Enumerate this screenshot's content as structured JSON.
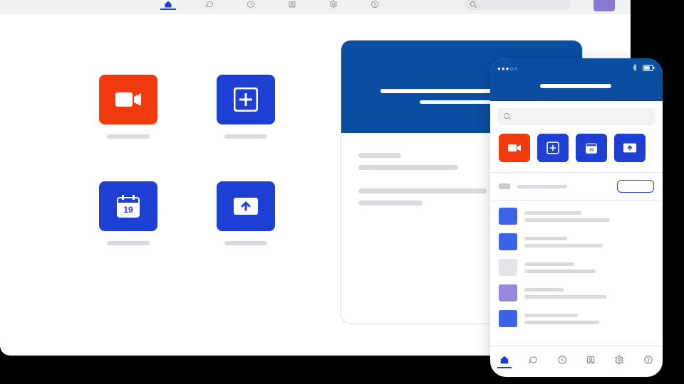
{
  "colors": {
    "brand_blue": "#1e3fd4",
    "header_blue": "#0a4ea1",
    "accent_orange": "#f13a0e",
    "accent_purple": "#8b77d4"
  },
  "desktop": {
    "nav": [
      {
        "icon": "home-icon",
        "active": true
      },
      {
        "icon": "chat-icon",
        "active": false
      },
      {
        "icon": "clock-icon",
        "active": false
      },
      {
        "icon": "contacts-icon",
        "active": false
      },
      {
        "icon": "gear-icon",
        "active": false
      },
      {
        "icon": "help-icon",
        "active": false
      }
    ],
    "search_placeholder": "",
    "tiles": [
      {
        "name": "new-meeting",
        "color": "orange",
        "icon": "video-icon",
        "label": ""
      },
      {
        "name": "join",
        "color": "blue",
        "icon": "plus-icon",
        "label": ""
      },
      {
        "name": "schedule",
        "color": "blue",
        "icon": "calendar-icon",
        "date": "19",
        "label": ""
      },
      {
        "name": "share",
        "color": "blue",
        "icon": "upload-icon",
        "label": ""
      }
    ]
  },
  "card": {
    "lines": 4
  },
  "phone": {
    "status": {
      "carrier": "●●●○○",
      "bluetooth": true,
      "battery": true
    },
    "title": "",
    "search_placeholder": "",
    "tiles": [
      {
        "name": "new-meeting",
        "color": "orange",
        "icon": "video-icon"
      },
      {
        "name": "join",
        "color": "blue",
        "icon": "plus-icon"
      },
      {
        "name": "schedule",
        "color": "blue",
        "icon": "calendar-icon",
        "date": "19"
      },
      {
        "name": "share",
        "color": "blue",
        "icon": "upload-icon"
      }
    ],
    "list": [
      {
        "thumb": "blue"
      },
      {
        "thumb": "blue"
      },
      {
        "thumb": "gray"
      },
      {
        "thumb": "purple"
      },
      {
        "thumb": "blue"
      }
    ],
    "tabs": [
      {
        "icon": "home-icon",
        "active": true
      },
      {
        "icon": "chat-icon",
        "active": false
      },
      {
        "icon": "clock-icon",
        "active": false
      },
      {
        "icon": "contacts-icon",
        "active": false
      },
      {
        "icon": "gear-icon",
        "active": false
      },
      {
        "icon": "help-icon",
        "active": false
      }
    ]
  }
}
